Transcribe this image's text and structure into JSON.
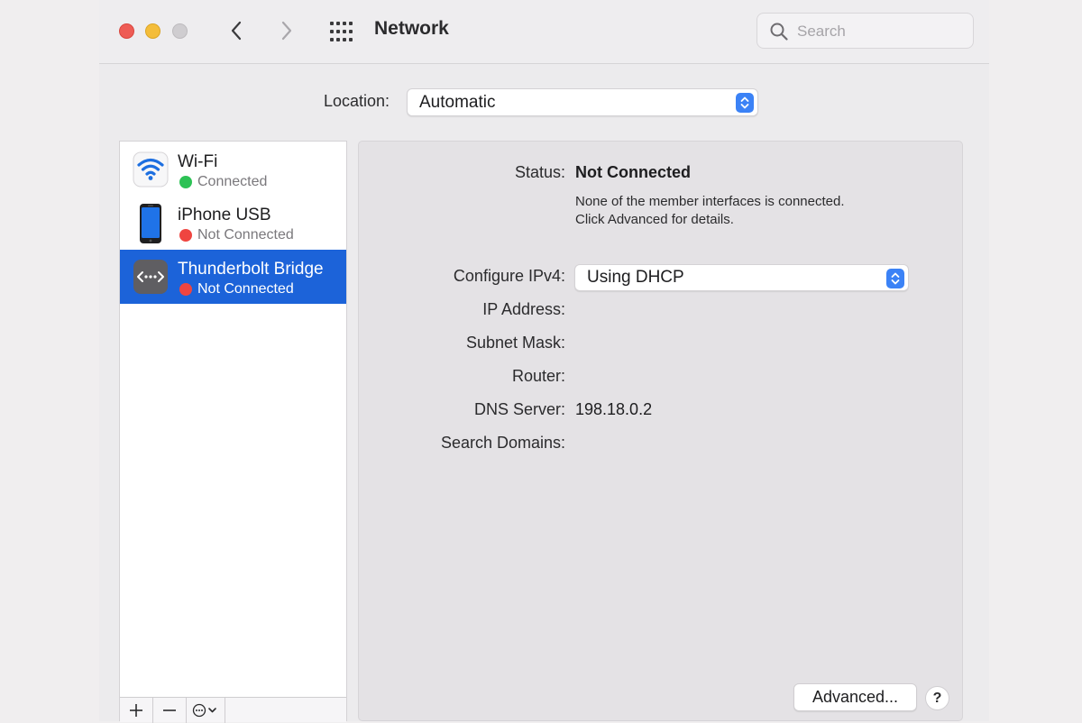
{
  "window": {
    "title": "Network",
    "search_placeholder": "Search"
  },
  "location": {
    "label": "Location:",
    "value": "Automatic"
  },
  "services": [
    {
      "name": "Wi-Fi",
      "status": "Connected",
      "status_color": "#2dc255",
      "icon": "wifi-icon",
      "selected": false
    },
    {
      "name": "iPhone USB",
      "status": "Not Connected",
      "status_color": "#ef4540",
      "icon": "iphone-icon",
      "selected": false
    },
    {
      "name": "Thunderbolt Bridge",
      "status": "Not Connected",
      "status_color": "#ef4540",
      "icon": "thunderbolt-bridge-icon",
      "selected": true
    }
  ],
  "sidebar_toolbar": {
    "add_icon": "plus-icon",
    "remove_icon": "minus-icon",
    "action_icon": "ellipsis-circle-icon"
  },
  "detail": {
    "status_label": "Status:",
    "status_value": "Not Connected",
    "status_desc_line1": "None of the member interfaces is connected.",
    "status_desc_line2": "Click Advanced for details.",
    "configure_label": "Configure IPv4:",
    "configure_value": "Using DHCP",
    "ip_label": "IP Address:",
    "subnet_label": "Subnet Mask:",
    "router_label": "Router:",
    "dns_label": "DNS Server:",
    "dns_value": "198.18.0.2",
    "search_domains_label": "Search Domains:",
    "advanced_label": "Advanced...",
    "help_label": "?"
  },
  "colors": {
    "accent": "#1c63d9",
    "stepper": "#3b82f6"
  }
}
